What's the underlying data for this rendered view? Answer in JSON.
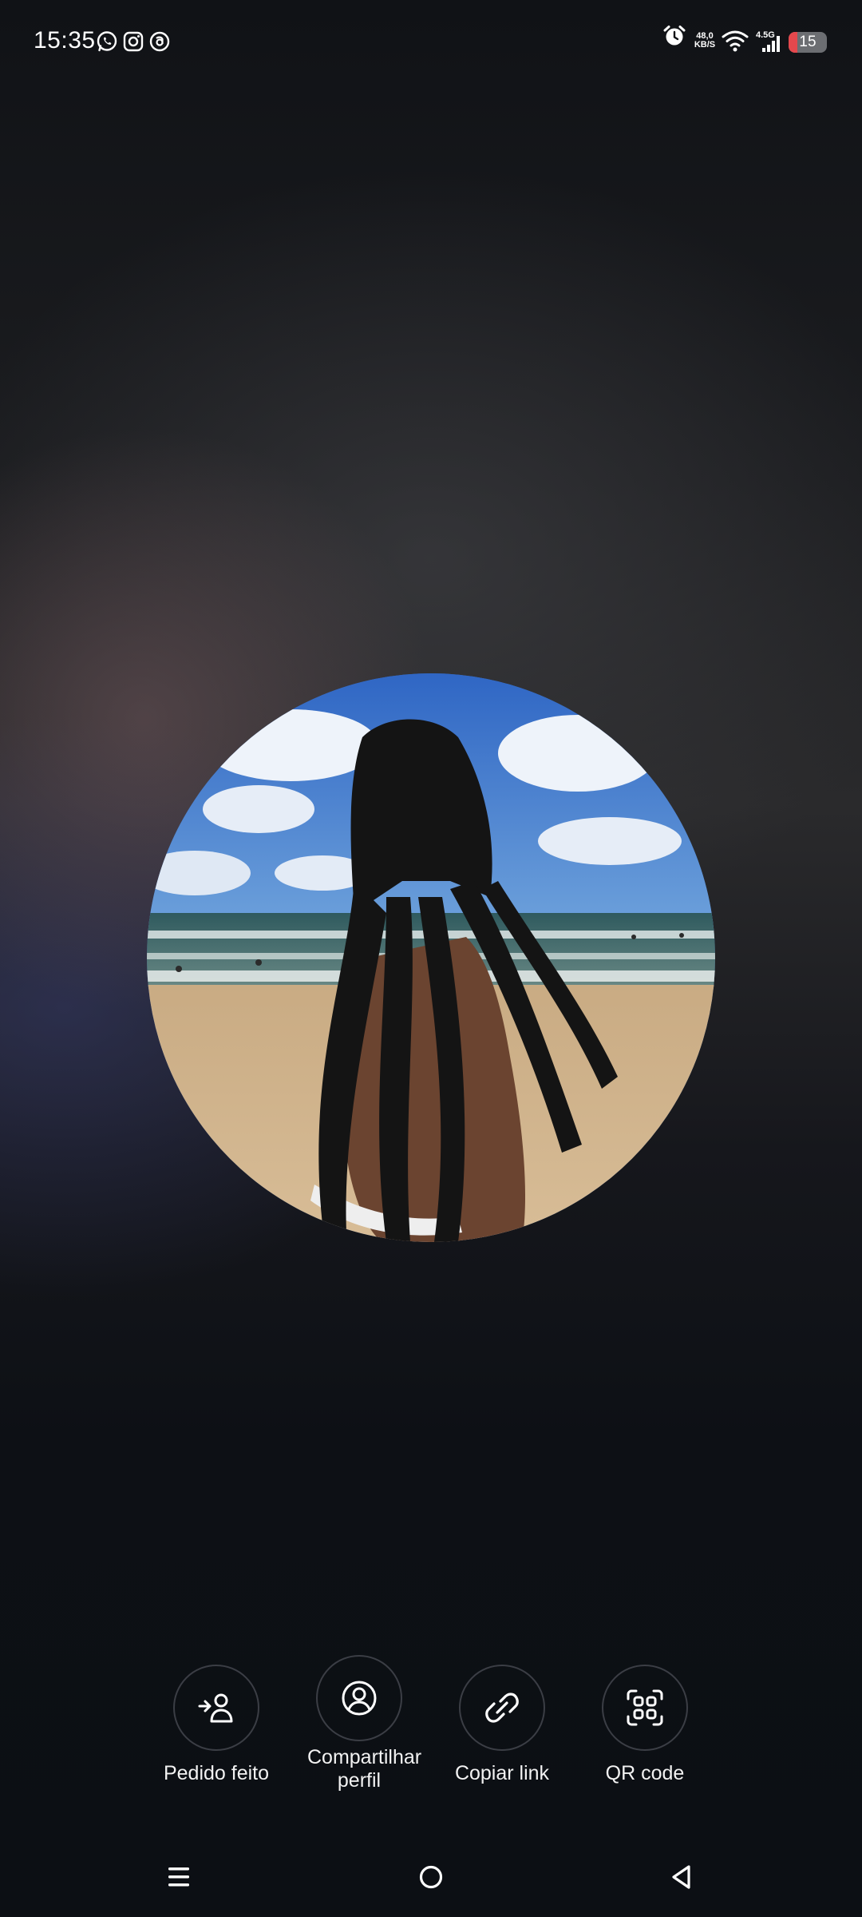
{
  "status_bar": {
    "time": "15:35",
    "network_speed_top": "48,0",
    "network_speed_bottom": "KB/S",
    "network_type": "4.5G",
    "battery": "15"
  },
  "actions": [
    {
      "label": "Pedido feito",
      "icon": "add-person-icon"
    },
    {
      "label": "Compartilhar perfil",
      "icon": "person-circle-icon"
    },
    {
      "label": "Copiar link",
      "icon": "link-icon"
    },
    {
      "label": "QR code",
      "icon": "qr-code-icon"
    }
  ],
  "colors": {
    "background": "#0e1014",
    "button_border": "#3b3e45",
    "text": "#f2f2f2",
    "battery_low": "#e5484d"
  }
}
